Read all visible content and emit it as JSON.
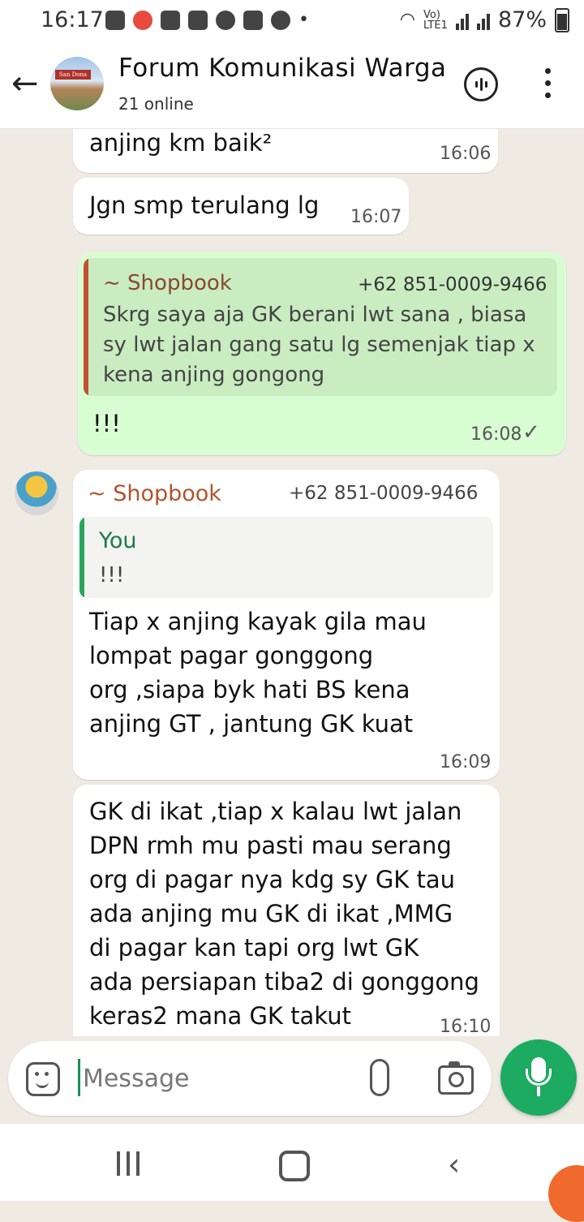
{
  "status_bar": {
    "time": "16:17",
    "network": "Vo) LTE1",
    "battery": "87%"
  },
  "header": {
    "avatar_sign": "San Dona",
    "title": "Forum Komunikasi Warga",
    "subtitle": "21 online"
  },
  "messages": [
    {
      "text": "anjing km baik²",
      "time": "16:06"
    },
    {
      "text": "Jgn smp terulang lg",
      "time": "16:07"
    },
    {
      "quote_sender": "~ Shopbook",
      "quote_phone": "+62 851-0009-9466",
      "quote_text": "Skrg saya aja GK berani lwt sana , biasa\nsy lwt jalan gang satu lg semenjak tiap x\nkena anjing gongong",
      "text": "!!!",
      "time": "16:08",
      "status": "✓"
    },
    {
      "sender": "~ Shopbook",
      "phone": "+62 851-0009-9466",
      "quote_author": "You",
      "quote_text": "!!!",
      "text": "Tiap x anjing kayak gila mau\nlompat pagar gonggong\norg ,siapa byk hati BS kena\nanjing GT , jantung GK kuat",
      "time": "16:09"
    },
    {
      "text": "GK di ikat ,tiap x kalau lwt jalan\nDPN rmh mu pasti mau serang\norg di pagar nya kdg sy GK tau\nada anjing mu GK di ikat ,MMG\ndi pagar kan tapi org lwt GK\nada persiapan tiba2 di gonggong\nkeras2 mana GK takut",
      "time": "16:10"
    }
  ],
  "composer": {
    "placeholder": "Message"
  },
  "nav": {
    "back_glyph": "‹"
  },
  "colors": {
    "outgoing_bubble": "#d9fdd3",
    "incoming_bubble": "#ffffff",
    "accent_green": "#1daa61",
    "chat_background": "#efeae2"
  }
}
